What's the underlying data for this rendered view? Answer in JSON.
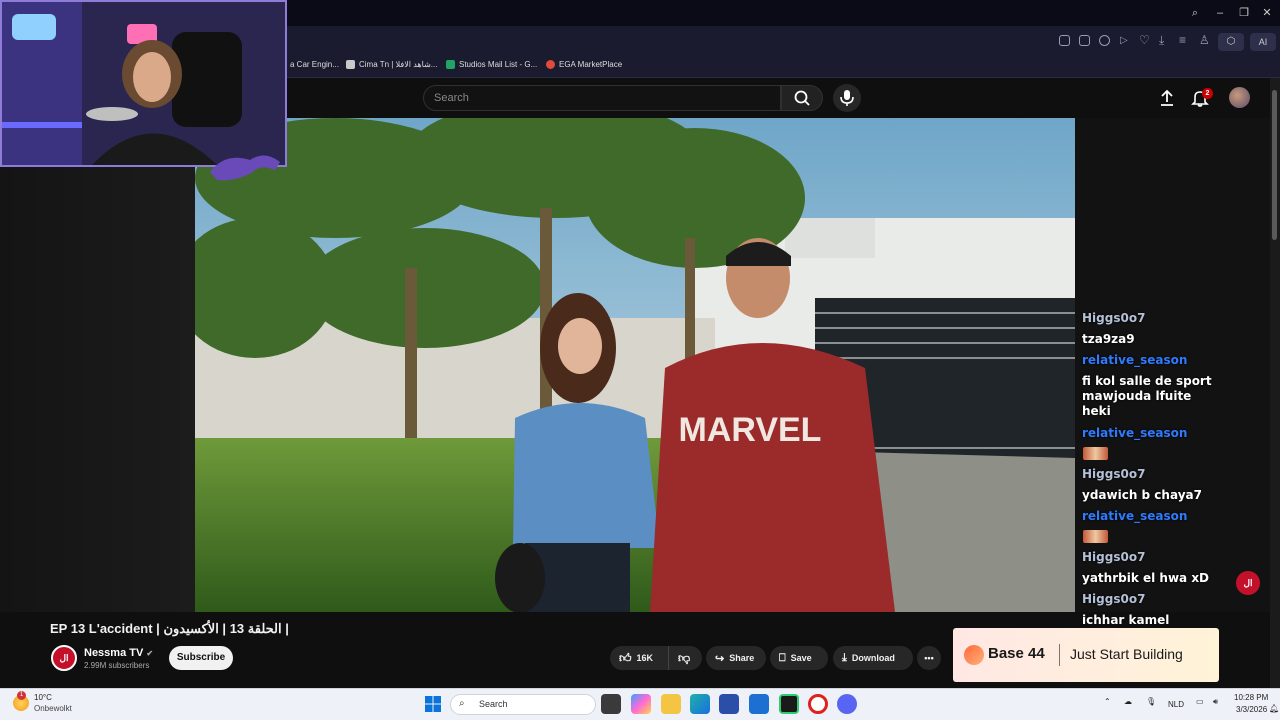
{
  "browser": {
    "bookmarks": [
      {
        "label": "a Car Engin...",
        "color": "#e8a23a"
      },
      {
        "label": "Cima Tn | شاهد الافلا...",
        "color": "#c9c9c9"
      },
      {
        "label": "Studios Mail List - G...",
        "color": "#21a366"
      },
      {
        "label": "EGA MarketPlace",
        "color": "#e34a3b"
      }
    ],
    "ai_label": "AI"
  },
  "youtube": {
    "search_placeholder": "Search",
    "notification_count": "2"
  },
  "chat": {
    "messages": [
      {
        "user": "Higgs0o7",
        "text": "tza9za9",
        "user_color": "grey"
      },
      {
        "user": "relative_season",
        "text": "fi kol salle de sport|mawjouda lfuite|heki",
        "user_color": "blue"
      },
      {
        "user": "relative_season",
        "text": "[emote]",
        "user_color": "blue"
      },
      {
        "user": "Higgs0o7",
        "text": "ydawich b chaya7",
        "user_color": "grey"
      },
      {
        "user": "relative_season",
        "text": "[emote]",
        "user_color": "blue"
      },
      {
        "user": "Higgs0o7",
        "text": "yathrbik el hwa xD",
        "user_color": "grey"
      },
      {
        "user": "Higgs0o7",
        "text": "ichhar kamel",
        "user_color": "grey"
      }
    ]
  },
  "video": {
    "title": "EP 13 L'accident | الحلقة 13 | الأكسيدون |",
    "shirt_text": "MARVEL",
    "channel_name": "Nessma TV",
    "subscribers": "2.99M subscribers",
    "subscribe_label": "Subscribe",
    "likes": "16K",
    "share_label": "Share",
    "save_label": "Save",
    "download_label": "Download"
  },
  "ad": {
    "brand": "Base 44",
    "tagline": "Just Start Building"
  },
  "taskbar": {
    "weather_temp": "10°C",
    "weather_desc": "Onbewolkt",
    "search_label": "Search",
    "language": "NLD",
    "time": "10:28 PM",
    "date": "3/3/2026"
  }
}
